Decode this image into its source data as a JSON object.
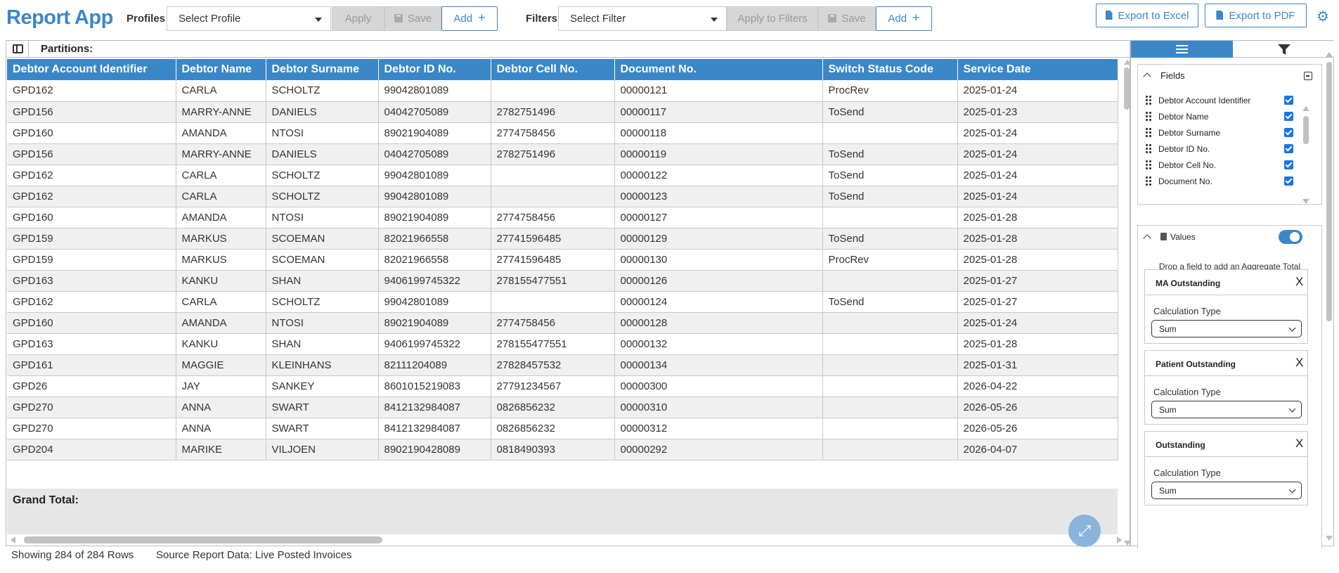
{
  "app": {
    "title": "Report App"
  },
  "toolbar": {
    "profiles_label": "Profiles",
    "profile_select": "Select Profile",
    "apply_label": "Apply",
    "save_label": "Save",
    "add_label": "Add",
    "filters_label": "Filters",
    "filter_select": "Select Filter",
    "apply_filters_label": "Apply to Filters",
    "filter_save_label": "Save",
    "filter_add_label": "Add",
    "export_excel_label": "Export to Excel",
    "export_pdf_label": "Export to PDF"
  },
  "table": {
    "partitions_label": "Partitions:",
    "columns": [
      "Debtor Account Identifier",
      "Debtor Name",
      "Debtor Surname",
      "Debtor ID No.",
      "Debtor Cell No.",
      "Document No.",
      "Switch Status Code",
      "Service Date"
    ],
    "rows": [
      [
        "GPD162",
        "CARLA",
        "SCHOLTZ",
        "99042801089",
        "",
        "00000121",
        "ProcRev",
        "2025-01-24"
      ],
      [
        "GPD156",
        "MARRY-ANNE",
        "DANIELS",
        "04042705089",
        "2782751496",
        "00000117",
        "ToSend",
        "2025-01-23"
      ],
      [
        "GPD160",
        "AMANDA",
        "NTOSI",
        "89021904089",
        "2774758456",
        "00000118",
        "",
        "2025-01-24"
      ],
      [
        "GPD156",
        "MARRY-ANNE",
        "DANIELS",
        "04042705089",
        "2782751496",
        "00000119",
        "ToSend",
        "2025-01-24"
      ],
      [
        "GPD162",
        "CARLA",
        "SCHOLTZ",
        "99042801089",
        "",
        "00000122",
        "ToSend",
        "2025-01-24"
      ],
      [
        "GPD162",
        "CARLA",
        "SCHOLTZ",
        "99042801089",
        "",
        "00000123",
        "ToSend",
        "2025-01-24"
      ],
      [
        "GPD160",
        "AMANDA",
        "NTOSI",
        "89021904089",
        "2774758456",
        "00000127",
        "",
        "2025-01-28"
      ],
      [
        "GPD159",
        "MARKUS",
        "SCOEMAN",
        "82021966558",
        "27741596485",
        "00000129",
        "ToSend",
        "2025-01-28"
      ],
      [
        "GPD159",
        "MARKUS",
        "SCOEMAN",
        "82021966558",
        "27741596485",
        "00000130",
        "ProcRev",
        "2025-01-28"
      ],
      [
        "GPD163",
        "KANKU",
        "SHAN",
        "9406199745322",
        "278155477551",
        "00000126",
        "",
        "2025-01-27"
      ],
      [
        "GPD162",
        "CARLA",
        "SCHOLTZ",
        "99042801089",
        "",
        "00000124",
        "ToSend",
        "2025-01-27"
      ],
      [
        "GPD160",
        "AMANDA",
        "NTOSI",
        "89021904089",
        "2774758456",
        "00000128",
        "",
        "2025-01-24"
      ],
      [
        "GPD163",
        "KANKU",
        "SHAN",
        "9406199745322",
        "278155477551",
        "00000132",
        "",
        "2025-01-28"
      ],
      [
        "GPD161",
        "MAGGIE",
        "KLEINHANS",
        "82111204089",
        "27828457532",
        "00000134",
        "",
        "2025-01-31"
      ],
      [
        "GPD26",
        "JAY",
        "SANKEY",
        "8601015219083",
        "27791234567",
        "00000300",
        "",
        "2026-04-22"
      ],
      [
        "GPD270",
        "ANNA",
        "SWART",
        "8412132984087",
        "0826856232",
        "00000310",
        "",
        "2026-05-26"
      ],
      [
        "GPD270",
        "ANNA",
        "SWART",
        "8412132984087",
        "0826856232",
        "00000312",
        "",
        "2026-05-26"
      ],
      [
        "GPD204",
        "MARIKE",
        "VILJOEN",
        "8902190428089",
        "0818490393",
        "00000292",
        "",
        "2026-04-07"
      ]
    ],
    "grand_total_label": "Grand Total:"
  },
  "footer": {
    "rows_text": "Showing 284 of 284 Rows",
    "source_text": "Source Report Data: Live Posted Invoices"
  },
  "side": {
    "fields_title": "Fields",
    "fields": [
      "Debtor Account Identifier",
      "Debtor Name",
      "Debtor Surname",
      "Debtor ID No.",
      "Debtor Cell No.",
      "Document No."
    ],
    "values_title": "Values",
    "drop_hint": "Drop a field to add an Aggregate Total",
    "aggregates": [
      {
        "title": "MA Outstanding",
        "calc_label": "Calculation Type",
        "calc_value": "Sum"
      },
      {
        "title": "Patient Outstanding",
        "calc_label": "Calculation Type",
        "calc_value": "Sum"
      },
      {
        "title": "Outstanding",
        "calc_label": "Calculation Type",
        "calc_value": "Sum"
      }
    ]
  },
  "colors": {
    "accent": "#3a87c8",
    "row_alt": "#f0f0f0",
    "disabled": "#d6d6d6"
  },
  "icons": [
    "save-icon",
    "plus-icon",
    "excel-icon",
    "pdf-icon",
    "gear-icon",
    "layout-icon",
    "list-icon",
    "funnel-icon",
    "chevron-up-icon",
    "collapse-icon",
    "grip-icon",
    "checkbox-icon",
    "calculator-icon",
    "toggle-icon",
    "close-icon",
    "expand-icon"
  ]
}
